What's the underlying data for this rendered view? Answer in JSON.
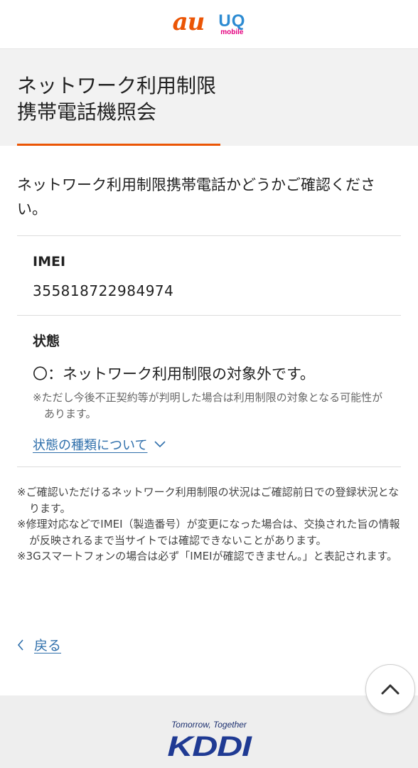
{
  "header": {
    "au_logo": "au",
    "uq_logo": "UQ",
    "uq_sub": "mobile"
  },
  "title": {
    "line1": "ネットワーク利用制限",
    "line2": "携帯電話機照会"
  },
  "intro": "ネットワーク利用制限携帯電話かどうかご確認ください。",
  "imei": {
    "label": "IMEI",
    "value": "355818722984974"
  },
  "status": {
    "label": "状態",
    "result": "〇：ネットワーク利用制限の対象外です。",
    "note": "※ただし今後不正契約等が判明した場合は利用制限の対象となる可能性があります。",
    "types_link": "状態の種類について"
  },
  "notes": [
    "※ご確認いただけるネットワーク利用制限の状況はご確認前日での登録状況となります。",
    "※修理対応などでIMEI（製造番号）が変更になった場合は、交換された旨の情報が反映されるまで当サイトでは確認できないことがあります。",
    "※3Gスマートフォンの場合は必ず「IMEIが確認できません。」と表記されます。"
  ],
  "back_label": "戻る",
  "footer": {
    "tagline": "Tomorrow, Together",
    "logo": "KDDI"
  },
  "colors": {
    "accent": "#eb5505",
    "link": "#2f6fab",
    "kddi_blue": "#1f3a93"
  },
  "icons": {
    "back": "chevron-left-icon",
    "expand": "chevron-down-icon",
    "scroll_top": "chevron-up-icon"
  }
}
